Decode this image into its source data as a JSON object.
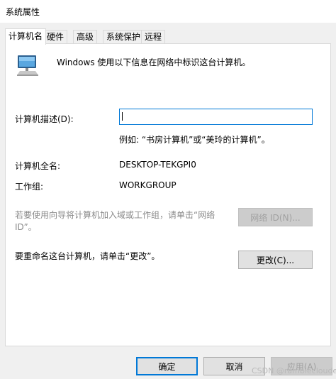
{
  "window": {
    "title": "系统属性"
  },
  "tabs": [
    {
      "label": "计算机名"
    },
    {
      "label": "硬件"
    },
    {
      "label": "高级"
    },
    {
      "label": "系统保护"
    },
    {
      "label": "远程"
    }
  ],
  "intro": {
    "text": "Windows 使用以下信息在网络中标识这台计算机。"
  },
  "description": {
    "label": "计算机描述(D):",
    "value": "",
    "example": "例如: “书房计算机”或“美玲的计算机”。"
  },
  "computer": {
    "full_name_label": "计算机全名:",
    "full_name_value": "DESKTOP-TEKGPI0",
    "workgroup_label": "工作组:",
    "workgroup_value": "WORKGROUP"
  },
  "network_id": {
    "text_line1": "若要使用向导将计算机加入域或工作组，请单击“网络",
    "text_line2": "ID”。",
    "button": "网络 ID(N)..."
  },
  "rename": {
    "text": "要重命名这台计算机，请单击“更改”。",
    "button": "更改(C)..."
  },
  "footer": {
    "ok": "确定",
    "cancel": "取消",
    "apply": "应用(A)"
  },
  "watermark": "CSDN @ramblecloude",
  "colors": {
    "accent": "#0078d7"
  }
}
